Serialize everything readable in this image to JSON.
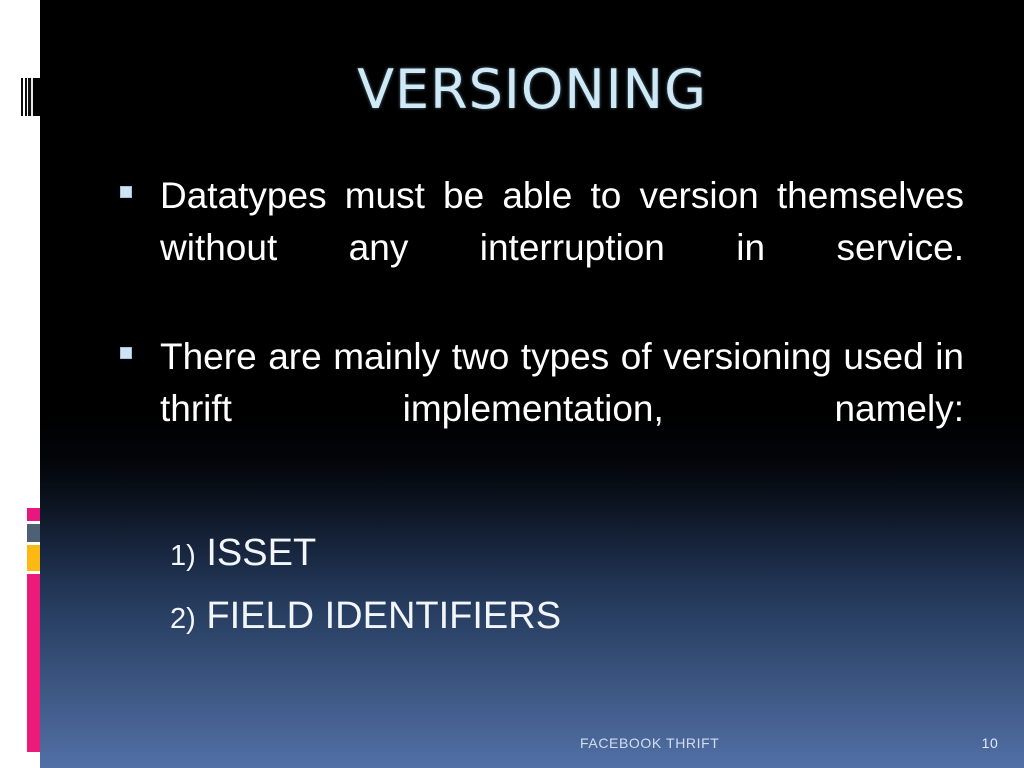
{
  "slide": {
    "title": "VERSIONING",
    "title_color": "#cfeaf6",
    "background_top_color": "#000000",
    "background_bottom_color": "#5170a6",
    "body_text_color": "#ffffff"
  },
  "bullets": [
    {
      "marker": "square-bullet",
      "text": "Datatypes must be able to version themselves without any interruption in service."
    },
    {
      "marker": "square-bullet",
      "text": "There are mainly two types of versioning used in thrift implementation, namely:"
    }
  ],
  "numbered_list": [
    {
      "number": "1)",
      "label": "ISSET"
    },
    {
      "number": "2)",
      "label": "FIELD IDENTIFIERS"
    }
  ],
  "footer": {
    "label": "FACEBOOK THRIFT",
    "page_number": "10"
  },
  "decor": {
    "barcode": "barcode-stripes",
    "markers": [
      {
        "name": "marker-pink-small",
        "color": "#e8177f"
      },
      {
        "name": "marker-slate",
        "color": "#4e6174"
      },
      {
        "name": "marker-yellow",
        "color": "#fdb913"
      },
      {
        "name": "marker-pink-long",
        "color": "#ec1a79"
      }
    ]
  }
}
